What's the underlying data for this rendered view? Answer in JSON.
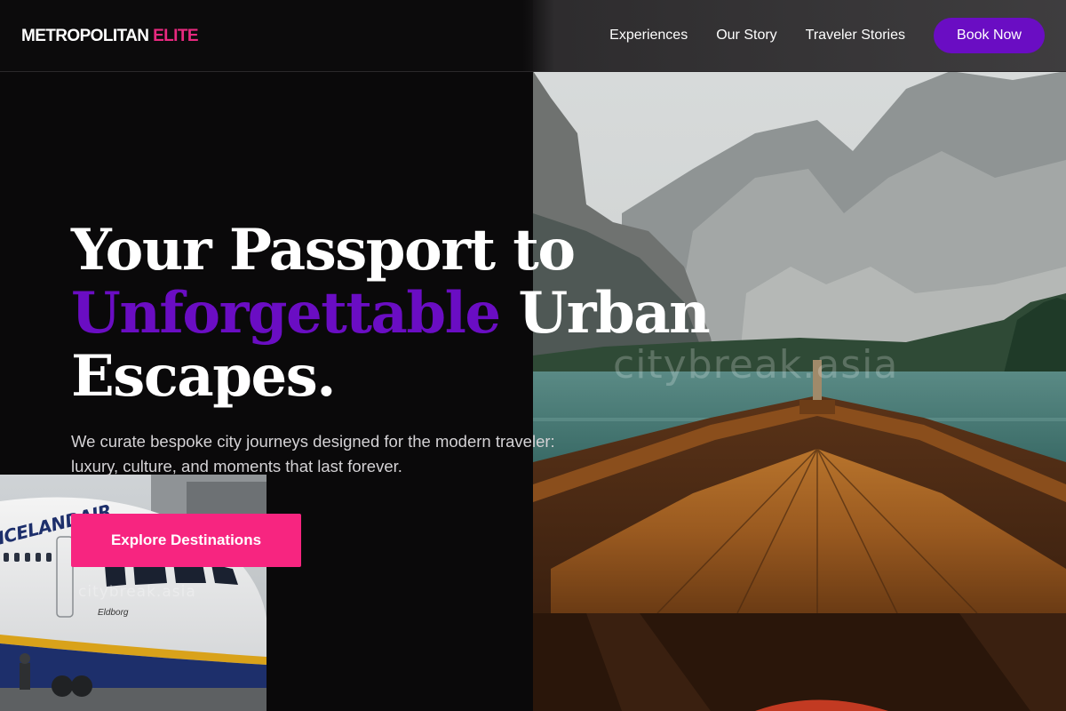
{
  "brand": {
    "name_main": "METROPOLITAN",
    "name_accent": "ELITE",
    "accent_color": "#e8297f"
  },
  "nav": {
    "links": [
      {
        "label": "Experiences"
      },
      {
        "label": "Our Story"
      },
      {
        "label": "Traveler Stories"
      }
    ],
    "cta_label": "Book Now",
    "cta_color": "#6a0dc3"
  },
  "hero": {
    "title_line1": "Your Passport to",
    "title_highlight": "Unforgettable",
    "title_rest": "Urban",
    "title_line3": "Escapes.",
    "highlight_color": "#6a0dc3",
    "subtitle": "We curate bespoke city journeys designed for the modern traveler: luxury, culture, and moments that last forever.",
    "cta_label": "Explore Destinations",
    "cta_color": "#f72580"
  },
  "images": {
    "lake_photo": {
      "watermark": "citybreak.asia"
    },
    "plane_photo": {
      "airline_text": "ICELANDAIR",
      "aircraft_name": "Eldborg",
      "watermark": "citybreak.asia"
    }
  }
}
